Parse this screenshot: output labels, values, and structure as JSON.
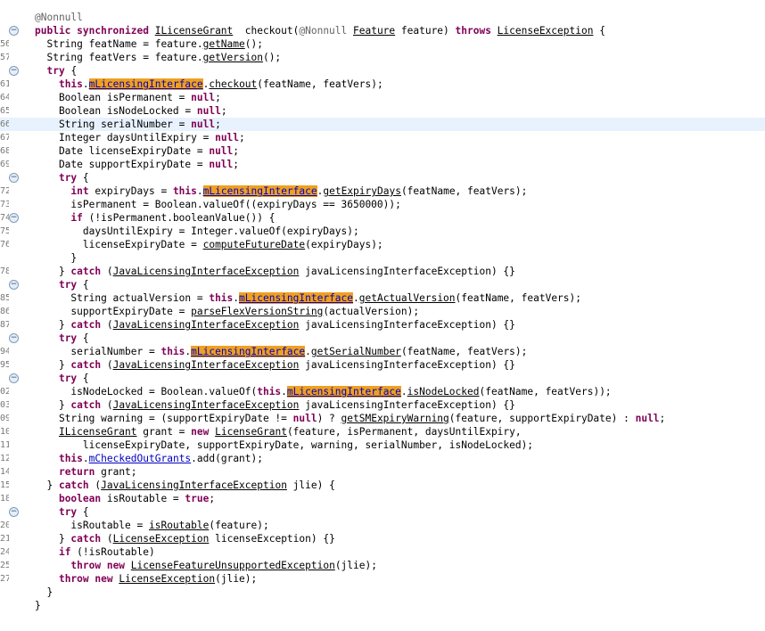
{
  "editor": {
    "colors": {
      "keyword": "#7f0055",
      "annotation": "#646464",
      "field_highlight": "#f0a020",
      "field_text": "#0000c0",
      "current_line": "#e8f2fe"
    },
    "current_line_index": 9,
    "lines": [
      {
        "num": "",
        "fold": false,
        "segs": [
          [
            "",
            ""
          ]
        ]
      },
      {
        "num": "",
        "fold": false,
        "segs": [
          [
            "a",
            "@Nonnull"
          ]
        ]
      },
      {
        "num": "",
        "fold": true,
        "segs": [
          [
            "k",
            "public synchronized "
          ],
          [
            "u",
            "ILicenseGrant"
          ],
          [
            "",
            "  checkout("
          ],
          [
            "a",
            "@Nonnull "
          ],
          [
            "u",
            "Feature"
          ],
          [
            "",
            " feature) "
          ],
          [
            "k",
            "throws "
          ],
          [
            "u",
            "LicenseException"
          ],
          [
            "",
            " {"
          ]
        ]
      },
      {
        "num": "56",
        "fold": false,
        "segs": [
          [
            "",
            "  String featName = feature."
          ],
          [
            "u",
            "getName"
          ],
          [
            "",
            "();"
          ]
        ]
      },
      {
        "num": "57",
        "fold": false,
        "segs": [
          [
            "",
            "  String featVers = feature."
          ],
          [
            "u",
            "getVersion"
          ],
          [
            "",
            "();"
          ]
        ]
      },
      {
        "num": "",
        "fold": true,
        "segs": [
          [
            "",
            "  "
          ],
          [
            "k",
            "try"
          ],
          [
            "",
            " {"
          ]
        ]
      },
      {
        "num": "61",
        "fold": false,
        "segs": [
          [
            "",
            "    "
          ],
          [
            "k",
            "this"
          ],
          [
            "",
            "."
          ],
          [
            "hl",
            "mLicensingInterface"
          ],
          [
            "",
            "."
          ],
          [
            "u",
            "checkout"
          ],
          [
            "",
            "(featName, featVers);"
          ]
        ]
      },
      {
        "num": "64",
        "fold": false,
        "segs": [
          [
            "",
            "    Boolean isPermanent = "
          ],
          [
            "k",
            "null"
          ],
          [
            "",
            ";"
          ]
        ]
      },
      {
        "num": "65",
        "fold": false,
        "segs": [
          [
            "",
            "    Boolean isNodeLocked = "
          ],
          [
            "k",
            "null"
          ],
          [
            "",
            ";"
          ]
        ]
      },
      {
        "num": "66",
        "fold": false,
        "segs": [
          [
            "",
            "    String serialNumber = "
          ],
          [
            "k",
            "null"
          ],
          [
            "",
            ";"
          ]
        ]
      },
      {
        "num": "67",
        "fold": false,
        "segs": [
          [
            "",
            "    Integer daysUntilExpiry = "
          ],
          [
            "k",
            "null"
          ],
          [
            "",
            ";"
          ]
        ]
      },
      {
        "num": "68",
        "fold": false,
        "segs": [
          [
            "",
            "    Date licenseExpiryDate = "
          ],
          [
            "k",
            "null"
          ],
          [
            "",
            ";"
          ]
        ]
      },
      {
        "num": "69",
        "fold": false,
        "segs": [
          [
            "",
            "    Date supportExpiryDate = "
          ],
          [
            "k",
            "null"
          ],
          [
            "",
            ";"
          ]
        ]
      },
      {
        "num": "",
        "fold": true,
        "segs": [
          [
            "",
            "    "
          ],
          [
            "k",
            "try"
          ],
          [
            "",
            " {"
          ]
        ]
      },
      {
        "num": "72",
        "fold": false,
        "segs": [
          [
            "",
            "      "
          ],
          [
            "k",
            "int"
          ],
          [
            "",
            " expiryDays = "
          ],
          [
            "k",
            "this"
          ],
          [
            "",
            "."
          ],
          [
            "hl",
            "mLicensingInterface"
          ],
          [
            "",
            "."
          ],
          [
            "u",
            "getExpiryDays"
          ],
          [
            "",
            "(featName, featVers);"
          ]
        ]
      },
      {
        "num": "73",
        "fold": false,
        "segs": [
          [
            "",
            "      isPermanent = Boolean.valueOf((expiryDays == 3650000));"
          ]
        ]
      },
      {
        "num": "74",
        "fold": true,
        "segs": [
          [
            "",
            "      "
          ],
          [
            "k",
            "if"
          ],
          [
            "",
            " (!isPermanent.booleanValue()) {"
          ]
        ]
      },
      {
        "num": "75",
        "fold": false,
        "segs": [
          [
            "",
            "        daysUntilExpiry = Integer.valueOf(expiryDays);"
          ]
        ]
      },
      {
        "num": "76",
        "fold": false,
        "segs": [
          [
            "",
            "        licenseExpiryDate = "
          ],
          [
            "u",
            "computeFutureDate"
          ],
          [
            "",
            "(expiryDays);"
          ]
        ]
      },
      {
        "num": "",
        "fold": false,
        "segs": [
          [
            "",
            "      }"
          ]
        ]
      },
      {
        "num": "78",
        "fold": false,
        "segs": [
          [
            "",
            "    } "
          ],
          [
            "k",
            "catch"
          ],
          [
            "",
            " ("
          ],
          [
            "u",
            "JavaLicensingInterfaceException"
          ],
          [
            "",
            " javaLicensingInterfaceException) {}"
          ]
        ]
      },
      {
        "num": "",
        "fold": true,
        "segs": [
          [
            "",
            "    "
          ],
          [
            "k",
            "try"
          ],
          [
            "",
            " {"
          ]
        ]
      },
      {
        "num": "85",
        "fold": false,
        "segs": [
          [
            "",
            "      String actualVersion = "
          ],
          [
            "k",
            "this"
          ],
          [
            "",
            "."
          ],
          [
            "hl",
            "mLicensingInterface"
          ],
          [
            "",
            "."
          ],
          [
            "u",
            "getActualVersion"
          ],
          [
            "",
            "(featName, featVers);"
          ]
        ]
      },
      {
        "num": "86",
        "fold": false,
        "segs": [
          [
            "",
            "      supportExpiryDate = "
          ],
          [
            "u",
            "parseFlexVersionString"
          ],
          [
            "",
            "(actualVersion);"
          ]
        ]
      },
      {
        "num": "87",
        "fold": false,
        "segs": [
          [
            "",
            "    } "
          ],
          [
            "k",
            "catch"
          ],
          [
            "",
            " ("
          ],
          [
            "u",
            "JavaLicensingInterfaceException"
          ],
          [
            "",
            " javaLicensingInterfaceException) {}"
          ]
        ]
      },
      {
        "num": "",
        "fold": true,
        "segs": [
          [
            "",
            "    "
          ],
          [
            "k",
            "try"
          ],
          [
            "",
            " {"
          ]
        ]
      },
      {
        "num": "94",
        "fold": false,
        "segs": [
          [
            "",
            "      serialNumber = "
          ],
          [
            "k",
            "this"
          ],
          [
            "",
            "."
          ],
          [
            "hl",
            "mLicensingInterface"
          ],
          [
            "",
            "."
          ],
          [
            "u",
            "getSerialNumber"
          ],
          [
            "",
            "(featName, featVers);"
          ]
        ]
      },
      {
        "num": "95",
        "fold": false,
        "segs": [
          [
            "",
            "    } "
          ],
          [
            "k",
            "catch"
          ],
          [
            "",
            " ("
          ],
          [
            "u",
            "JavaLicensingInterfaceException"
          ],
          [
            "",
            " javaLicensingInterfaceException) {}"
          ]
        ]
      },
      {
        "num": "",
        "fold": true,
        "segs": [
          [
            "",
            "    "
          ],
          [
            "k",
            "try"
          ],
          [
            "",
            " {"
          ]
        ]
      },
      {
        "num": "02",
        "fold": false,
        "segs": [
          [
            "",
            "      isNodeLocked = Boolean.valueOf("
          ],
          [
            "k",
            "this"
          ],
          [
            "",
            "."
          ],
          [
            "hl",
            "mLicensingInterface"
          ],
          [
            "",
            "."
          ],
          [
            "u",
            "isNodeLocked"
          ],
          [
            "",
            "(featName, featVers));"
          ]
        ]
      },
      {
        "num": "03",
        "fold": false,
        "segs": [
          [
            "",
            "    } "
          ],
          [
            "k",
            "catch"
          ],
          [
            "",
            " ("
          ],
          [
            "u",
            "JavaLicensingInterfaceException"
          ],
          [
            "",
            " javaLicensingInterfaceException) {}"
          ]
        ]
      },
      {
        "num": "09",
        "fold": false,
        "segs": [
          [
            "",
            "    String warning = (supportExpiryDate != "
          ],
          [
            "k",
            "null"
          ],
          [
            "",
            ") ? "
          ],
          [
            "u",
            "getSMExpiryWarning"
          ],
          [
            "",
            "(feature, supportExpiryDate) : "
          ],
          [
            "k",
            "null"
          ],
          [
            "",
            ";"
          ]
        ]
      },
      {
        "num": "10",
        "fold": false,
        "segs": [
          [
            "",
            "    "
          ],
          [
            "u",
            "ILicenseGrant"
          ],
          [
            "",
            " grant = "
          ],
          [
            "k",
            "new"
          ],
          [
            "",
            " "
          ],
          [
            "u",
            "LicenseGrant"
          ],
          [
            "",
            "(feature, isPermanent, daysUntilExpiry,"
          ]
        ]
      },
      {
        "num": "11",
        "fold": false,
        "segs": [
          [
            "",
            "        licenseExpiryDate, supportExpiryDate, warning, serialNumber, isNodeLocked);"
          ]
        ]
      },
      {
        "num": "12",
        "fold": false,
        "segs": [
          [
            "",
            "    "
          ],
          [
            "k",
            "this"
          ],
          [
            "",
            "."
          ],
          [
            "n",
            "mCheckedOutGrants"
          ],
          [
            "",
            ".add(grant);"
          ]
        ]
      },
      {
        "num": "14",
        "fold": false,
        "segs": [
          [
            "",
            "    "
          ],
          [
            "k",
            "return"
          ],
          [
            "",
            " grant;"
          ]
        ]
      },
      {
        "num": "15",
        "fold": false,
        "segs": [
          [
            "",
            "  } "
          ],
          [
            "k",
            "catch"
          ],
          [
            "",
            " ("
          ],
          [
            "u",
            "JavaLicensingInterfaceException"
          ],
          [
            "",
            " jlie) {"
          ]
        ]
      },
      {
        "num": "18",
        "fold": false,
        "segs": [
          [
            "",
            "    "
          ],
          [
            "k",
            "boolean"
          ],
          [
            "",
            " isRoutable = "
          ],
          [
            "k",
            "true"
          ],
          [
            "",
            ";"
          ]
        ]
      },
      {
        "num": "",
        "fold": true,
        "segs": [
          [
            "",
            "    "
          ],
          [
            "k",
            "try"
          ],
          [
            "",
            " {"
          ]
        ]
      },
      {
        "num": "20",
        "fold": false,
        "segs": [
          [
            "",
            "      isRoutable = "
          ],
          [
            "u",
            "isRoutable"
          ],
          [
            "",
            "(feature);"
          ]
        ]
      },
      {
        "num": "21",
        "fold": false,
        "segs": [
          [
            "",
            "    } "
          ],
          [
            "k",
            "catch"
          ],
          [
            "",
            " ("
          ],
          [
            "u",
            "LicenseException"
          ],
          [
            "",
            " licenseException) {}"
          ]
        ]
      },
      {
        "num": "24",
        "fold": false,
        "segs": [
          [
            "",
            "    "
          ],
          [
            "k",
            "if"
          ],
          [
            "",
            " (!isRoutable)"
          ]
        ]
      },
      {
        "num": "25",
        "fold": false,
        "segs": [
          [
            "",
            "      "
          ],
          [
            "k",
            "throw new"
          ],
          [
            "",
            " "
          ],
          [
            "u",
            "LicenseFeatureUnsupportedException"
          ],
          [
            "",
            "(jlie);"
          ]
        ]
      },
      {
        "num": "27",
        "fold": false,
        "segs": [
          [
            "",
            "    "
          ],
          [
            "k",
            "throw new"
          ],
          [
            "",
            " "
          ],
          [
            "u",
            "LicenseException"
          ],
          [
            "",
            "(jlie);"
          ]
        ]
      },
      {
        "num": "",
        "fold": false,
        "segs": [
          [
            "",
            "  }"
          ]
        ]
      },
      {
        "num": "",
        "fold": false,
        "segs": [
          [
            "",
            "}"
          ]
        ]
      }
    ]
  }
}
